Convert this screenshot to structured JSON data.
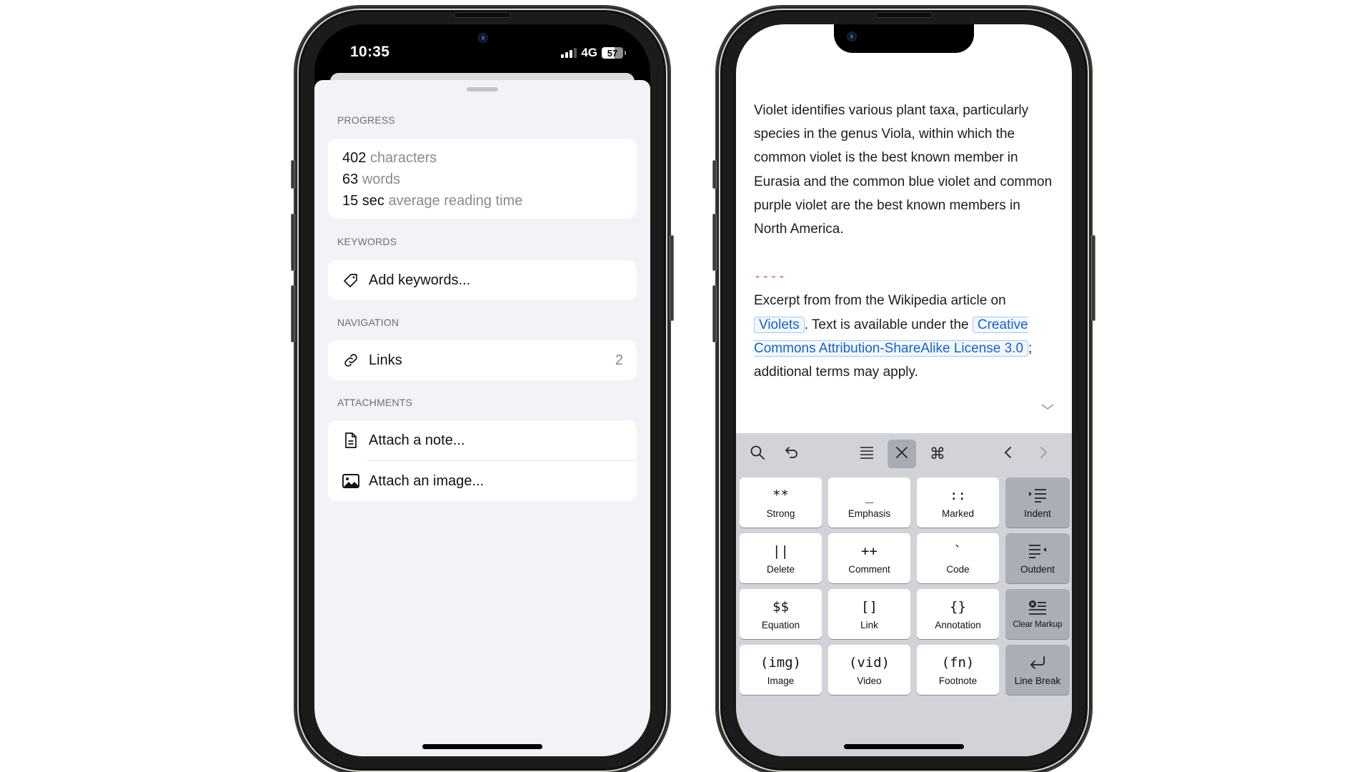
{
  "left_phone": {
    "status_bar": {
      "time": "10:35",
      "network": "4G",
      "battery": "57",
      "signal_bars_active": 3,
      "signal_bars_total": 4
    },
    "sheet": {
      "sections": [
        {
          "header": "PROGRESS",
          "stats": [
            {
              "value": "402",
              "label": "characters"
            },
            {
              "value": "63",
              "label": "words"
            },
            {
              "value": "15 sec",
              "label": "average reading time"
            }
          ]
        },
        {
          "header": "KEYWORDS",
          "rows": [
            {
              "icon": "tag-icon",
              "label": "Add keywords..."
            }
          ]
        },
        {
          "header": "NAVIGATION",
          "rows": [
            {
              "icon": "link-icon",
              "label": "Links",
              "count": "2"
            }
          ]
        },
        {
          "header": "ATTACHMENTS",
          "rows": [
            {
              "icon": "document-icon",
              "label": "Attach a note..."
            },
            {
              "icon": "photo-icon",
              "label": "Attach an image..."
            }
          ]
        }
      ]
    }
  },
  "right_phone": {
    "article": {
      "paragraph1": "Violet identifies various plant taxa, particularly species in the genus Viola, within which the common violet is the best known member in Eurasia and the common blue violet and common purple violet are the best known members in North America.",
      "rule": "----",
      "p2_before": "Excerpt from from the Wikipedia article on ",
      "link1": "Violets",
      "p2_middle": ". Text is available under the ",
      "link2": "Creative Commons Attribution-ShareAlike License 3.0",
      "p2_after": "; additional terms may apply."
    },
    "toolbar": {
      "buttons": [
        {
          "icon": "search-icon"
        },
        {
          "icon": "undo-icon"
        },
        {
          "icon": "paragraph-menu-icon"
        },
        {
          "icon": "close-icon",
          "active": true
        },
        {
          "icon": "command-icon"
        },
        {
          "icon": "chevron-left-icon"
        },
        {
          "icon": "chevron-right-icon",
          "disabled": true
        }
      ]
    },
    "keys": [
      {
        "glyph": "**",
        "label": "Strong"
      },
      {
        "glyph": "_",
        "label": "Emphasis"
      },
      {
        "glyph": "::",
        "label": "Marked"
      },
      {
        "glyph": "",
        "label": "Indent",
        "icon": "indent-icon",
        "func": true
      },
      {
        "glyph": "||",
        "label": "Delete"
      },
      {
        "glyph": "++",
        "label": "Comment"
      },
      {
        "glyph": "`",
        "label": "Code"
      },
      {
        "glyph": "",
        "label": "Outdent",
        "icon": "outdent-icon",
        "func": true
      },
      {
        "glyph": "$$",
        "label": "Equation"
      },
      {
        "glyph": "[]",
        "label": "Link"
      },
      {
        "glyph": "{}",
        "label": "Annotation"
      },
      {
        "glyph": "",
        "label": "Clear Markup",
        "icon": "clear-markup-icon",
        "func": true
      },
      {
        "glyph": "(img)",
        "label": "Image"
      },
      {
        "glyph": "(vid)",
        "label": "Video"
      },
      {
        "glyph": "(fn)",
        "label": "Footnote"
      },
      {
        "glyph": "",
        "label": "Line Break",
        "icon": "return-icon",
        "func": true
      }
    ],
    "colors": {
      "link": "#1a62c4",
      "rule": "#d0322f",
      "keyboard_bg": "#d1d3d9"
    }
  }
}
